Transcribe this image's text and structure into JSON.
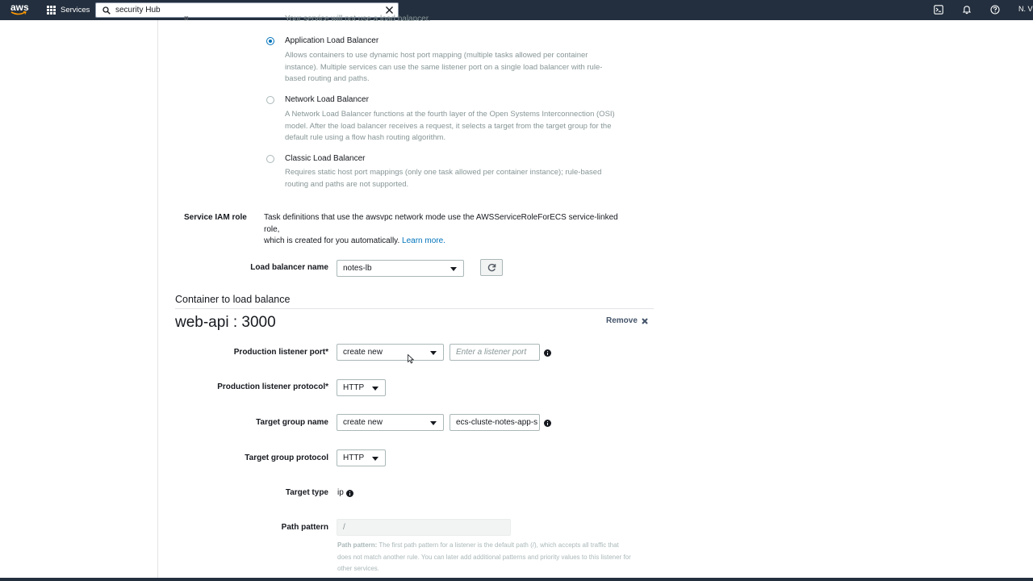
{
  "nav": {
    "logo_text": "aws",
    "services_label": "Services",
    "search_value": "security Hub",
    "region_text": "N. Vi"
  },
  "page": {
    "cut_text": "Your service will not use a load balancer.",
    "cut_mark": "¤",
    "lb_options": [
      {
        "title": "Application Load Balancer",
        "selected": true,
        "desc_lines": [
          "Allows containers to use dynamic host port mapping (multiple tasks allowed per container",
          "instance). Multiple services can use the same listener port on a single load balancer with rule-",
          "based routing and paths."
        ]
      },
      {
        "title": "Network Load Balancer",
        "selected": false,
        "desc_lines": [
          "A Network Load Balancer functions at the fourth layer of the Open Systems Interconnection (OSI)",
          "model. After the load balancer receives a request, it selects a target from the target group for the",
          "default rule using a flow hash routing algorithm."
        ]
      },
      {
        "title": "Classic Load Balancer",
        "selected": false,
        "desc_lines": [
          "Requires static host port mappings (only one task allowed per container instance); rule-based",
          "routing and paths are not supported."
        ]
      }
    ],
    "iam": {
      "label": "Service IAM role",
      "text_line1": "Task definitions that use the awsvpc network mode use the AWSServiceRoleForECS service-linked role,",
      "text_line2": "which is created for you automatically.",
      "learn_more": "Learn more."
    },
    "lb_name": {
      "label": "Load balancer name",
      "value": "notes-lb"
    },
    "container_section_title": "Container to load balance",
    "container_name": "web-api : 3000",
    "remove_label": "Remove",
    "prod_listener_port": {
      "label": "Production listener port*",
      "select_value": "create new",
      "input_placeholder": "Enter a listener port"
    },
    "prod_listener_protocol": {
      "label": "Production listener protocol*",
      "value": "HTTP"
    },
    "target_group_name": {
      "label": "Target group name",
      "select_value": "create new",
      "input_value": "ecs-cluste-notes-app-s"
    },
    "target_group_protocol": {
      "label": "Target group protocol",
      "value": "HTTP"
    },
    "target_type": {
      "label": "Target type",
      "value": "ip"
    },
    "path_pattern": {
      "label": "Path pattern",
      "value": "/",
      "help_bold": "Path pattern:",
      "help_line1": "The first path pattern for a listener is the default path (/), which accepts all traffic that",
      "help_line2": "does not match another rule. You can later add additional patterns and priority values to this listener for",
      "help_line3": "other services."
    }
  },
  "colors": {
    "nav_bg": "#232f3e",
    "link": "#0073bb",
    "muted_text": "#879596"
  }
}
